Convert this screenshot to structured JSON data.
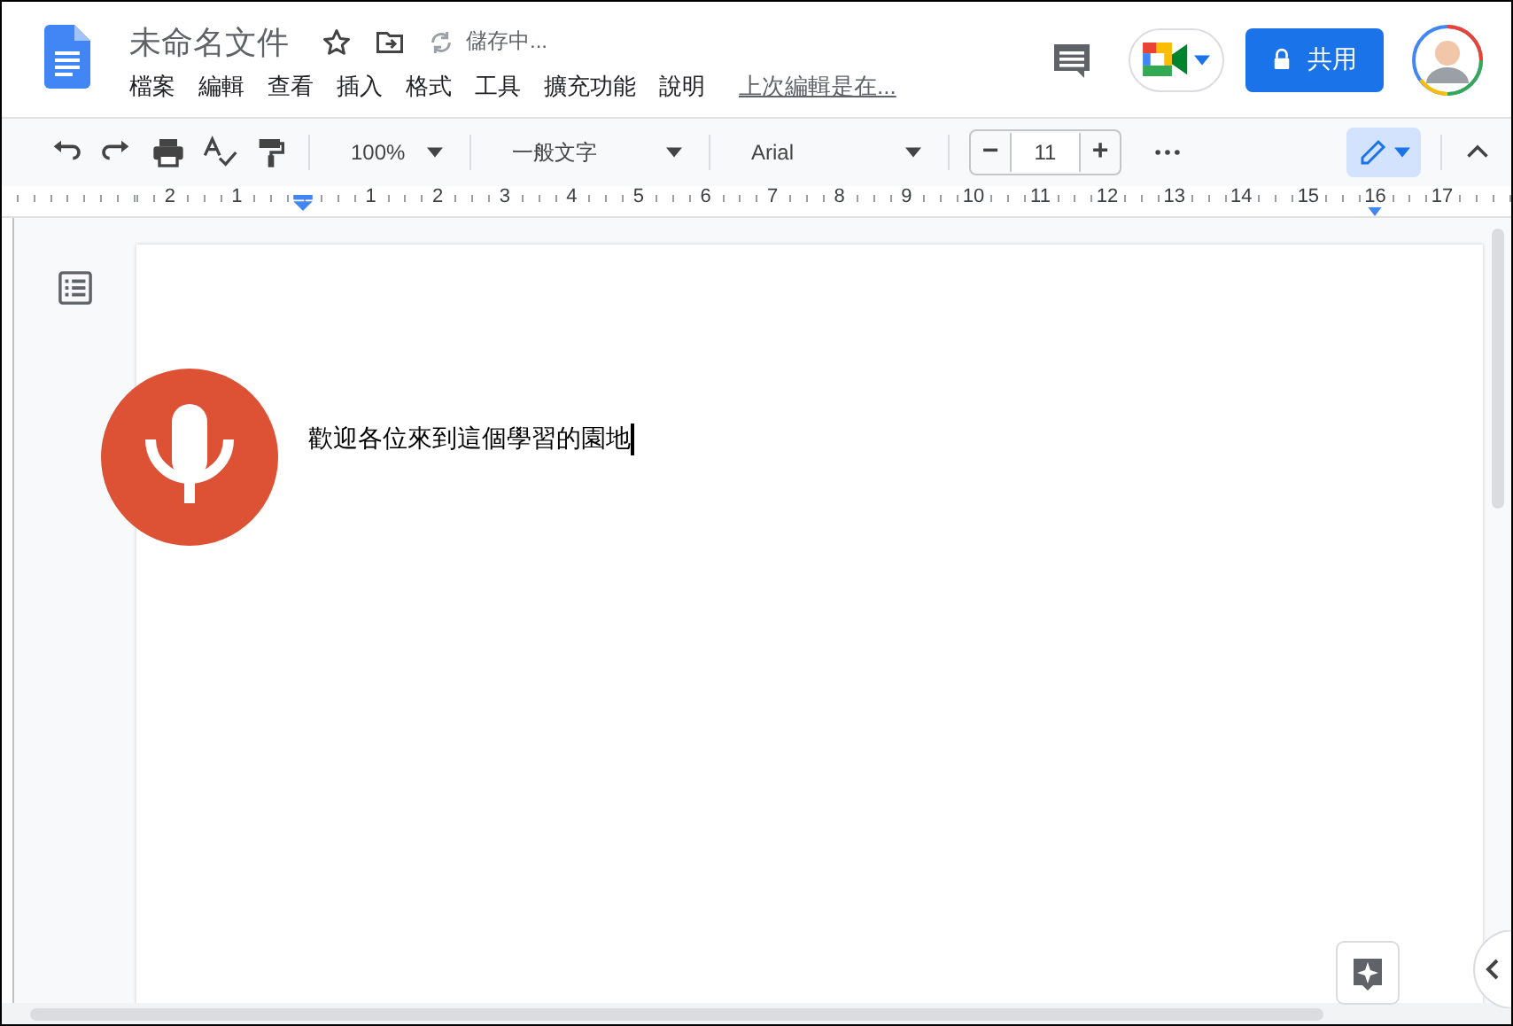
{
  "doc": {
    "title": "未命名文件",
    "save_status": "儲存中..."
  },
  "menu": [
    {
      "label": "檔案"
    },
    {
      "label": "編輯"
    },
    {
      "label": "查看"
    },
    {
      "label": "插入"
    },
    {
      "label": "格式"
    },
    {
      "label": "工具"
    },
    {
      "label": "擴充功能"
    },
    {
      "label": "說明"
    }
  ],
  "last_edit": "上次編輯是在...",
  "share_button": "共用",
  "toolbar": {
    "zoom": "100%",
    "style": "一般文字",
    "font": "Arial",
    "font_size": "11",
    "size_minus": "−",
    "size_plus": "+"
  },
  "ruler": {
    "before_indent": [
      "2",
      "1"
    ],
    "after_indent": [
      "1",
      "2",
      "3",
      "4",
      "5",
      "6",
      "7",
      "8",
      "9",
      "10",
      "11",
      "12",
      "13",
      "14",
      "15",
      "16",
      "17"
    ]
  },
  "body_text": "歡迎各位來到這個學習的園地",
  "dictation": {
    "listening": true
  }
}
